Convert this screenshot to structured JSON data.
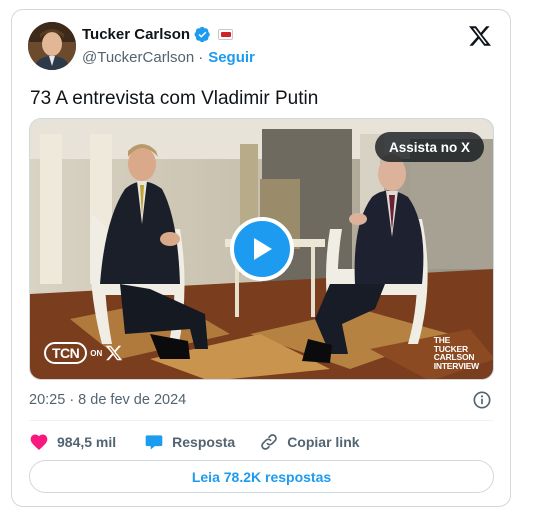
{
  "author": {
    "name": "Tucker Carlson",
    "handle": "@TuckerCarlson",
    "separator": "·",
    "follow_label": "Seguir",
    "verified_icon": "verified-badge-icon",
    "affiliate_icon": "tcn-affiliate-badge-icon"
  },
  "header": {
    "platform_icon": "x-logo-icon"
  },
  "tweet": {
    "text": "73 A entrevista com Vladimir Putin"
  },
  "media": {
    "watch_label": "Assista no X",
    "play_icon": "play-icon",
    "logo_tcn": "TCN",
    "logo_on": "ON",
    "logo_x": "X",
    "watermark_lines": [
      "THE",
      "TUCKER",
      "CARLSON",
      "INTERVIEW"
    ]
  },
  "meta": {
    "timestamp": "20:25 · 8 de fev de 2024",
    "info_icon": "info-icon"
  },
  "actions": {
    "likes": "984,5 mil",
    "reply_label": "Resposta",
    "copy_label": "Copiar link"
  },
  "read_replies_label": "Leia 78.2K respostas",
  "colors": {
    "accent": "#1d9bf0",
    "like": "#f91880",
    "text": "#0f1419",
    "secondary": "#536471",
    "border": "#cfd9de"
  }
}
